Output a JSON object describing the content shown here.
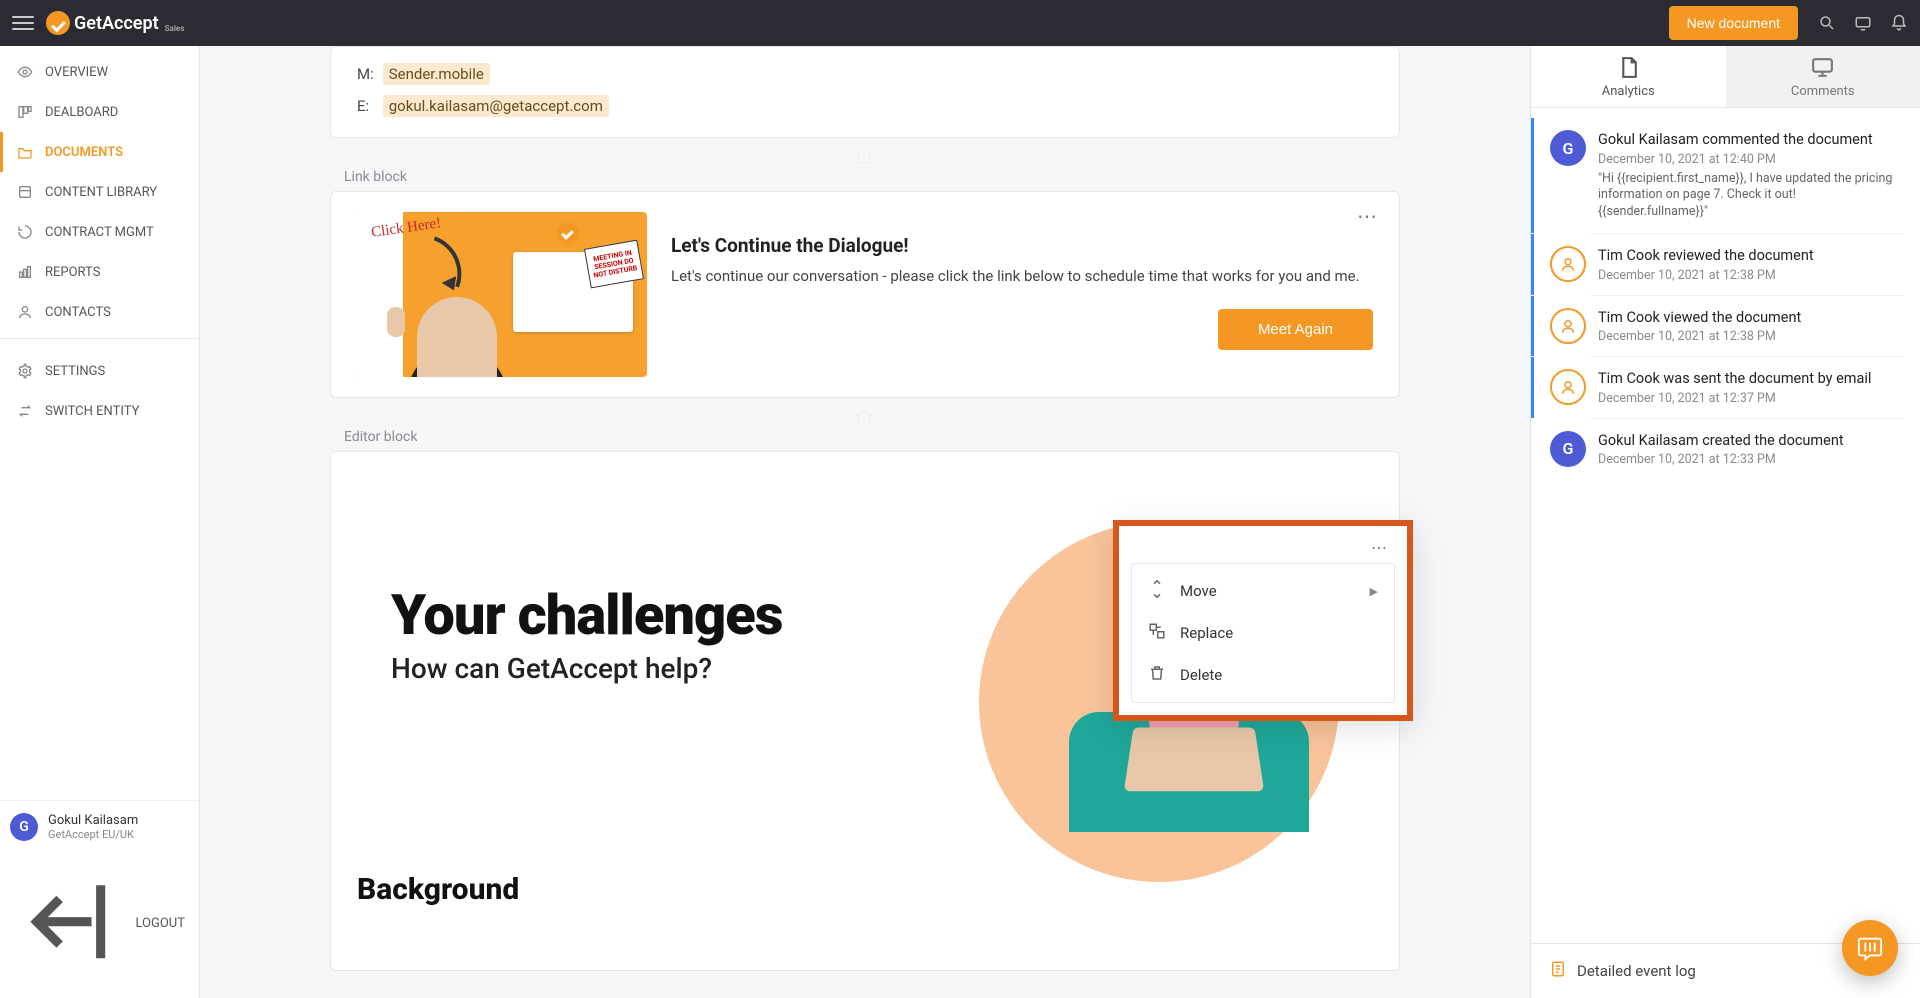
{
  "brand": {
    "name": "GetAccept",
    "sub": "Sales"
  },
  "topbar": {
    "new_document": "New document"
  },
  "sidebar": {
    "items": [
      {
        "label": "OVERVIEW"
      },
      {
        "label": "DEALBOARD"
      },
      {
        "label": "DOCUMENTS"
      },
      {
        "label": "CONTENT LIBRARY"
      },
      {
        "label": "CONTRACT MGMT"
      },
      {
        "label": "REPORTS"
      },
      {
        "label": "CONTACTS"
      }
    ],
    "settings_items": [
      {
        "label": "SETTINGS"
      },
      {
        "label": "SWITCH ENTITY"
      }
    ],
    "user": {
      "initial": "G",
      "name": "Gokul Kailasam",
      "org": "GetAccept EU/UK"
    },
    "logout": "LOGOUT"
  },
  "sender_block": {
    "mobile_label": "M:",
    "mobile_value": "Sender.mobile",
    "email_label": "E:",
    "email_value": "gokul.kailasam@getaccept.com"
  },
  "link_block": {
    "label": "Link block",
    "title": "Let's Continue the Dialogue!",
    "body": "Let's continue our conversation - please click the link below to schedule time that works for you and me.",
    "cta": "Meet Again",
    "thumb_clickhere": "Click Here!",
    "thumb_sign": "MEETING IN SESSION DO NOT DISTURB"
  },
  "editor_block": {
    "label": "Editor block",
    "headline": "Your challenges",
    "sub": "How can GetAccept help?",
    "section": "Background"
  },
  "context_menu": {
    "move": "Move",
    "replace": "Replace",
    "delete": "Delete"
  },
  "right": {
    "tab_analytics": "Analytics",
    "tab_comments": "Comments",
    "feed": [
      {
        "avatar": "G",
        "avclass": "blue",
        "title": "Gokul Kailasam commented the document",
        "date": "December 10, 2021 at 12:40 PM",
        "quote": "\"Hi {{recipient.first_name}}, I have updated the pricing information on page 7. Check it out! {{sender.fullname}}\"",
        "unread": true
      },
      {
        "avatar": "",
        "avclass": "ring",
        "title": "Tim Cook reviewed the document",
        "date": "December 10, 2021 at 12:38 PM",
        "unread": true
      },
      {
        "avatar": "",
        "avclass": "ring",
        "title": "Tim Cook viewed the document",
        "date": "December 10, 2021 at 12:38 PM",
        "unread": true
      },
      {
        "avatar": "",
        "avclass": "ring",
        "title": "Tim Cook was sent the document by email",
        "date": "December 10, 2021 at 12:37 PM",
        "unread": true
      },
      {
        "avatar": "G",
        "avclass": "blue",
        "title": "Gokul Kailasam created the document",
        "date": "December 10, 2021 at 12:33 PM",
        "unread": false
      }
    ],
    "detailed": "Detailed event log"
  }
}
